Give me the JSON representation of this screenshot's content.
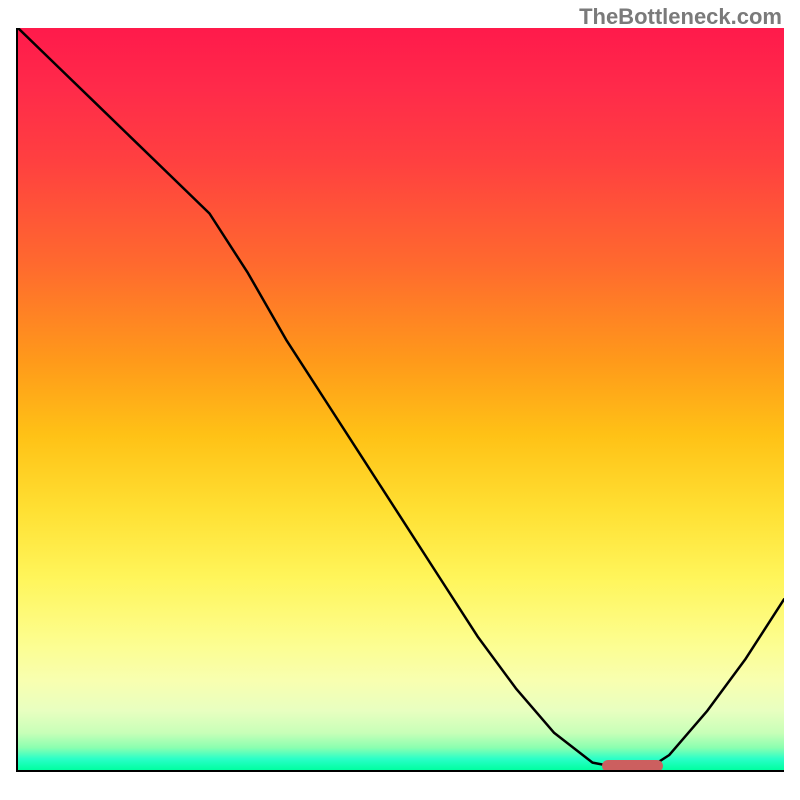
{
  "watermark": "TheBottleneck.com",
  "chart_data": {
    "type": "line",
    "title": "",
    "xlabel": "",
    "ylabel": "",
    "xlim": [
      0,
      100
    ],
    "ylim": [
      0,
      100
    ],
    "x": [
      0,
      5,
      10,
      15,
      20,
      25,
      30,
      35,
      40,
      45,
      50,
      55,
      60,
      65,
      70,
      75,
      80,
      82,
      85,
      90,
      95,
      100
    ],
    "values": [
      100,
      95,
      90,
      85,
      80,
      75,
      67,
      58,
      50,
      42,
      34,
      26,
      18,
      11,
      5,
      1,
      0,
      0,
      2,
      8,
      15,
      23
    ],
    "gradient_top_color": "#ff1a4b",
    "gradient_bottom_color": "#00ffa0",
    "curve_color": "#000000",
    "marker": {
      "color": "#cc5f5f",
      "x_start": 76,
      "x_end": 84,
      "y": 0
    }
  }
}
